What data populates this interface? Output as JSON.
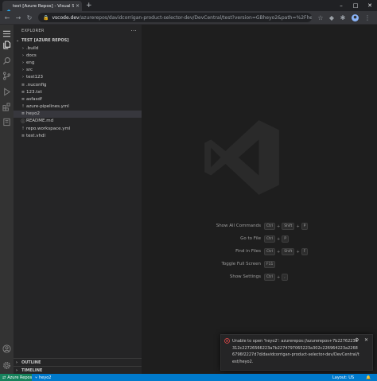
{
  "browser": {
    "tab_title": "test [Azure Repos] - Visual Studio",
    "tab_close": "×",
    "new_tab": "+",
    "controls": {
      "minimize": "–",
      "maximize": "□",
      "close": "✕"
    },
    "url_host": "vscode.dev",
    "url_path": "/azurerepos/davidcorrigan-product-selector-dev/DevCentral/test?version=GBheyo2&path=%2Fheyo2"
  },
  "explorer": {
    "title": "EXPLORER",
    "more": "···",
    "workspace": "TEST [AZURE REPOS]",
    "items": [
      {
        "label": ".build",
        "icon": "›"
      },
      {
        "label": "docs",
        "icon": "›"
      },
      {
        "label": "eng",
        "icon": "›"
      },
      {
        "label": "src",
        "icon": "›"
      },
      {
        "label": "test123",
        "icon": "›"
      },
      {
        "label": ".nuconfig",
        "icon": "≡"
      },
      {
        "label": "123.txt",
        "icon": "≡"
      },
      {
        "label": "asfasdf",
        "icon": "≡"
      },
      {
        "label": "azure-pipelines.yml",
        "icon": "!"
      },
      {
        "label": "heyo2",
        "icon": "≡"
      },
      {
        "label": "README.md",
        "icon": "ⓘ"
      },
      {
        "label": "repo.workspace.yml",
        "icon": "!"
      },
      {
        "label": "test.vhdl",
        "icon": "≡"
      }
    ],
    "outline": "OUTLINE",
    "timeline": "TIMELINE"
  },
  "shortcuts": [
    {
      "label": "Show All Commands",
      "keys": [
        "Ctrl",
        "Shift",
        "P"
      ]
    },
    {
      "label": "Go to File",
      "keys": [
        "Ctrl",
        "P"
      ]
    },
    {
      "label": "Find in Files",
      "keys": [
        "Ctrl",
        "Shift",
        "F"
      ]
    },
    {
      "label": "Toggle Full Screen",
      "keys": [
        "F11"
      ]
    },
    {
      "label": "Show Settings",
      "keys": [
        "Ctrl",
        ","
      ]
    }
  ],
  "notification": {
    "message": "Unable to open 'heyo2': azurerepos://azurerepos+7b2276223a312c22726566223a7b2274797065223a302c226964223a22686796f2227d7d/davidcorrigan-product-selector-dev/DevCentral/test/heyo2.",
    "settings": "⚙",
    "close": "✕"
  },
  "statusbar": {
    "remote": "Azure Repos",
    "branch": "heyo2",
    "layout": "Layout: US",
    "bell": "🔔"
  },
  "colors": {
    "activity_bar": "#333333",
    "sidebar": "#252526",
    "editor": "#1e1e1e",
    "statusbar": "#007acc",
    "remote": "#16825d",
    "error": "#f14c4c"
  }
}
